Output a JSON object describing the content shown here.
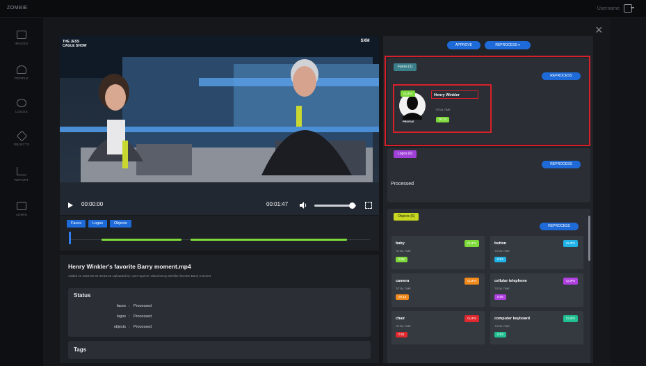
{
  "topbar": {
    "brand": "ZOMBIE",
    "user": "Username"
  },
  "sidebar": {
    "items": [
      {
        "label": "IMAGES",
        "icon": "image-icon"
      },
      {
        "label": "PEOPLE",
        "icon": "people-icon"
      },
      {
        "label": "LOGOS",
        "icon": "logo-icon"
      },
      {
        "label": "OBJECTS",
        "icon": "objects-icon"
      },
      {
        "label": "REPORT",
        "icon": "report-icon"
      },
      {
        "label": "ADMIN",
        "icon": "admin-icon"
      }
    ]
  },
  "video": {
    "show_logo": "THE JESS CAGLE SHOW",
    "network_logo": "SXM",
    "current_time": "00:00:00",
    "duration": "00:01:47",
    "volume_level": 0.9
  },
  "timeline": {
    "tabs": [
      "Faces",
      "Logos",
      "Objects"
    ]
  },
  "file": {
    "title": "Henry Winkler's favorite Barry moment.mp4",
    "meta": "Added on 2023-05-04 09:50:46   Uploaded by: user mpd   ID: video/Henry-Winkler-favorite-Barry-moment",
    "status_title": "Status",
    "status": [
      {
        "key": "faces",
        "value": "Processed"
      },
      {
        "key": "logos",
        "value": "Processed"
      },
      {
        "key": "objects",
        "value": "Processed"
      }
    ],
    "tags_title": "Tags"
  },
  "right": {
    "approve": "APPROVE",
    "reprocess": "REPROCESS",
    "faces_pill": "Faces (1)",
    "logos_pill": "Logos (0)",
    "objects_pill": "Objects (6)",
    "reprocess_small": "REPROCESS",
    "processed_text": "Processed",
    "face": {
      "clips": "CLIPS",
      "name": "Henry Winkler",
      "total_label": "TOTAL TIME",
      "time": "00:23",
      "profile": "PROFILE"
    },
    "objects": [
      {
        "name": "baby",
        "clips": "CLIPS",
        "total": "TOTAL TIME",
        "time": "0:08",
        "color": "#7ed93a"
      },
      {
        "name": "button",
        "clips": "CLIPS",
        "total": "TOTAL TIME",
        "time": "0:04",
        "color": "#1fb3e8"
      },
      {
        "name": "camera",
        "clips": "CLIPS",
        "total": "TOTAL TIME",
        "time": "00:13",
        "color": "#f08a1c"
      },
      {
        "name": "cellular telephone",
        "clips": "CLIPS",
        "total": "TOTAL TIME",
        "time": "0:05",
        "color": "#b040e0"
      },
      {
        "name": "chair",
        "clips": "CLIPS",
        "total": "TOTAL TIME",
        "time": "0:01",
        "color": "#e0282e"
      },
      {
        "name": "computer keyboard",
        "clips": "CLIPS",
        "total": "TOTAL TIME",
        "time": "0:03",
        "color": "#20c090"
      }
    ]
  }
}
